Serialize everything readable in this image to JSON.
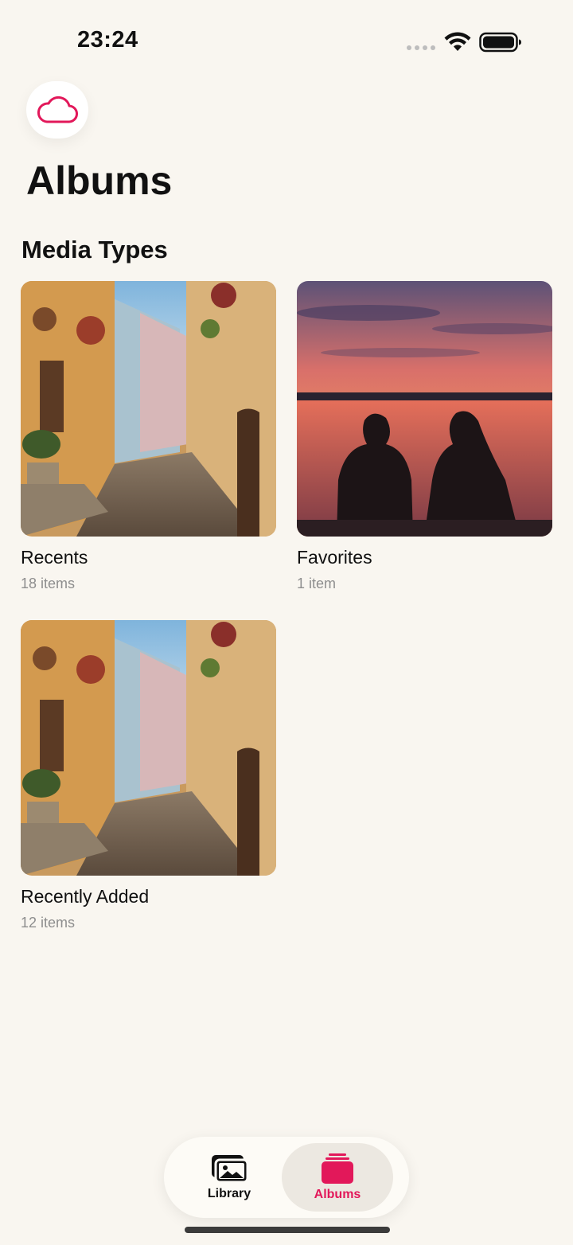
{
  "status_bar": {
    "time": "23:24"
  },
  "header": {
    "cloud_icon": "cloud-icon",
    "title": "Albums"
  },
  "sections": {
    "media_types_title": "Media Types"
  },
  "albums": [
    {
      "name": "Recents",
      "count": "18 items",
      "thumbnail": "street-photo"
    },
    {
      "name": "Favorites",
      "count": "1 item",
      "thumbnail": "sunset-photo"
    },
    {
      "name": "Recently Added",
      "count": "12 items",
      "thumbnail": "street-photo"
    }
  ],
  "tab_bar": {
    "library_label": "Library",
    "albums_label": "Albums",
    "active": "Albums"
  },
  "colors": {
    "accent": "#e2185a",
    "background": "#f9f6f0"
  }
}
